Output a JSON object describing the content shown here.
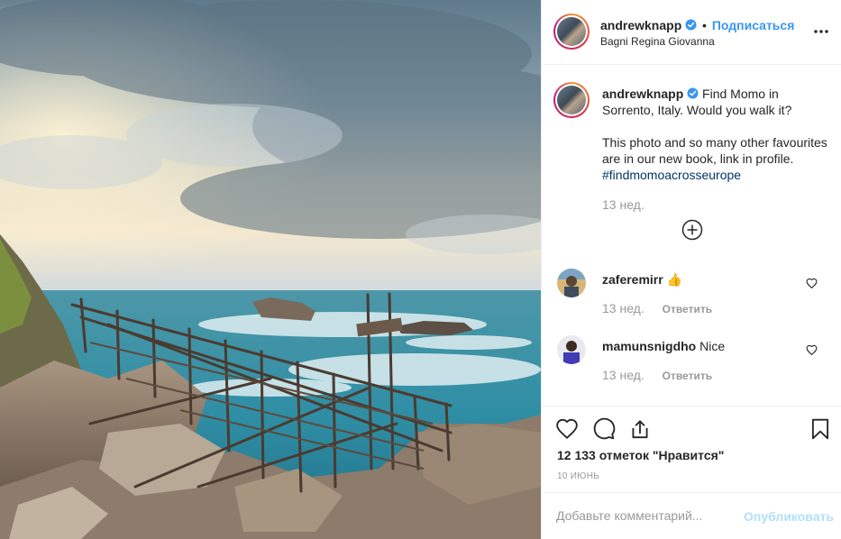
{
  "post": {
    "author": {
      "username": "andrewknapp",
      "follow_label": "Подписаться",
      "separator": "•",
      "location": "Bagni Regina Giovanna"
    },
    "caption": {
      "username": "andrewknapp",
      "text_line1": "Find Momo in Sorrento, Italy. Would you walk it?",
      "text_line2": "This photo and so many other favourites are in our new book, link in profile.",
      "hashtag": "#findmomoacrosseurope",
      "time": "13 нед."
    },
    "comments": [
      {
        "username": "zaferemirr",
        "text": "👍",
        "time": "13 нед.",
        "reply_label": "Ответить"
      },
      {
        "username": "mamunsnigdho",
        "text": "Nice",
        "time": "13 нед.",
        "reply_label": "Ответить"
      }
    ],
    "likes_text": "12 133 отметок \"Нравится\"",
    "date": "10 ИЮНЬ",
    "add_comment": {
      "placeholder": "Добавьте комментарий...",
      "publish_label": "Опубликовать"
    }
  },
  "icons": {
    "more": "more-horizontal-icon",
    "expand": "plus-circle-icon",
    "like": "heart-icon",
    "comment": "comment-icon",
    "share": "share-icon",
    "save": "bookmark-icon",
    "verified": "verified-badge-icon"
  },
  "colors": {
    "link_blue": "#3897f0",
    "hashtag": "#003569",
    "muted_text": "#999999",
    "publish_disabled": "#b2dffc",
    "verified": "#3897f0"
  }
}
